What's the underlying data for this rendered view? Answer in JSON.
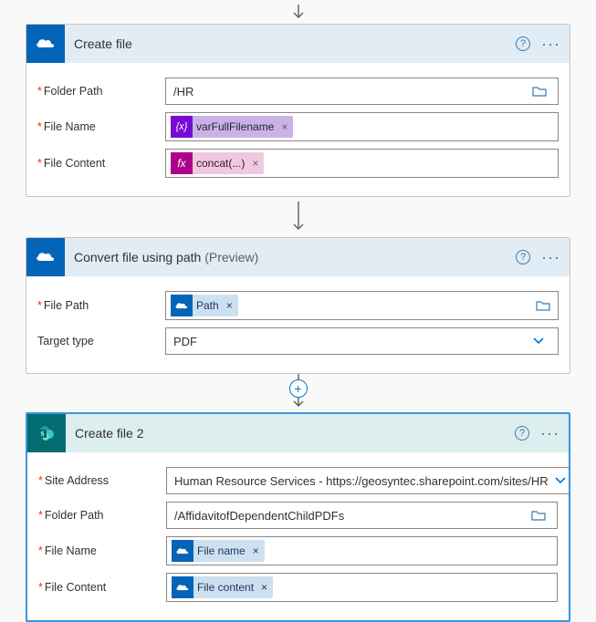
{
  "arrow_glyph": "↓",
  "plus_glyph": "+",
  "card1": {
    "title": "Create file",
    "fields": {
      "folder_path_label": "Folder Path",
      "folder_path_value": "/HR",
      "file_name_label": "File Name",
      "file_name_token": "varFullFilename",
      "file_content_label": "File Content",
      "file_content_token": "concat(...)"
    }
  },
  "card2": {
    "title": "Convert file using path",
    "preview": "(Preview)",
    "fields": {
      "file_path_label": "File Path",
      "file_path_token": "Path",
      "target_type_label": "Target type",
      "target_type_value": "PDF"
    }
  },
  "card3": {
    "title": "Create file 2",
    "fields": {
      "site_address_label": "Site Address",
      "site_address_value": "Human Resource Services - https://geosyntec.sharepoint.com/sites/HR",
      "folder_path_label": "Folder Path",
      "folder_path_value": "/AffidavitofDependentChildPDFs",
      "file_name_label": "File Name",
      "file_name_token": "File name",
      "file_content_label": "File Content",
      "file_content_token": "File content"
    }
  },
  "icons": {
    "help": "?",
    "more": "···",
    "close": "×",
    "var": "{x}",
    "fx": "fx"
  }
}
